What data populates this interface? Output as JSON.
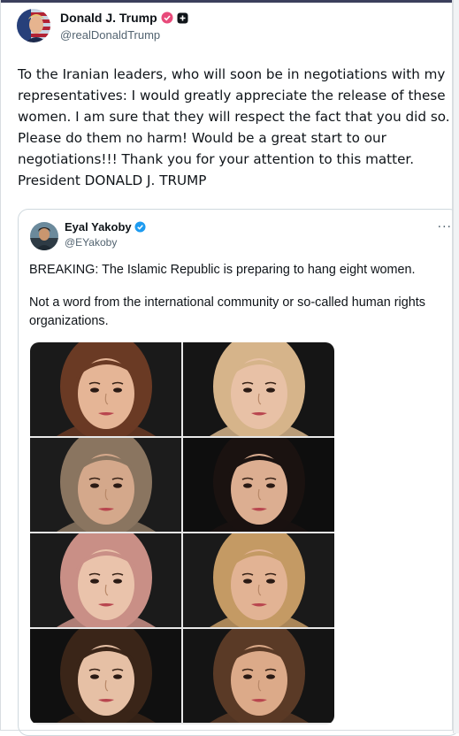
{
  "post": {
    "author_name": "Donald J. Trump",
    "author_handle": "@realDonaldTrump",
    "text": "To the Iranian leaders, who will soon be in negotiations with my representatives: I would greatly appreciate the release of these women. I am sure that they will respect the fact that you did so. Please do them no harm! Would be a great start to our negotiations!!! Thank you for your attention to this matter. President DONALD J. TRUMP"
  },
  "quote": {
    "author_name": "Eyal Yakoby",
    "author_handle": "@EYakoby",
    "more_label": "···",
    "paragraph1": "BREAKING: The Islamic Republic is preparing to hang eight women.",
    "paragraph2": "Not a word from the international community or so-called human rights organizations."
  },
  "photos": [
    {
      "hair": "#6a3a24",
      "bg": "#1a1a1a",
      "skin": "#e5b596"
    },
    {
      "hair": "#d6b48a",
      "bg": "#151515",
      "skin": "#e8c1a6"
    },
    {
      "hair": "#8a7560",
      "bg": "#1c1c1c",
      "skin": "#d4a88b"
    },
    {
      "hair": "#1a1210",
      "bg": "#0e0e0e",
      "skin": "#dcae91"
    },
    {
      "hair": "#c98f86",
      "bg": "#1b1b1b",
      "skin": "#eac3ab"
    },
    {
      "hair": "#c49a64",
      "bg": "#1a1a1a",
      "skin": "#e2b394"
    },
    {
      "hair": "#3a2518",
      "bg": "#101010",
      "skin": "#e6c0a5"
    },
    {
      "hair": "#5a3a26",
      "bg": "#141414",
      "skin": "#dcaa89"
    }
  ],
  "colors": {
    "verified_blue": "#1d9bf0",
    "badge_pink": "#e84a7a",
    "text_secondary": "#536471"
  },
  "icons": [
    "verified-pink-icon",
    "plus-badge-icon",
    "verified-blue-icon",
    "more-options-icon"
  ]
}
